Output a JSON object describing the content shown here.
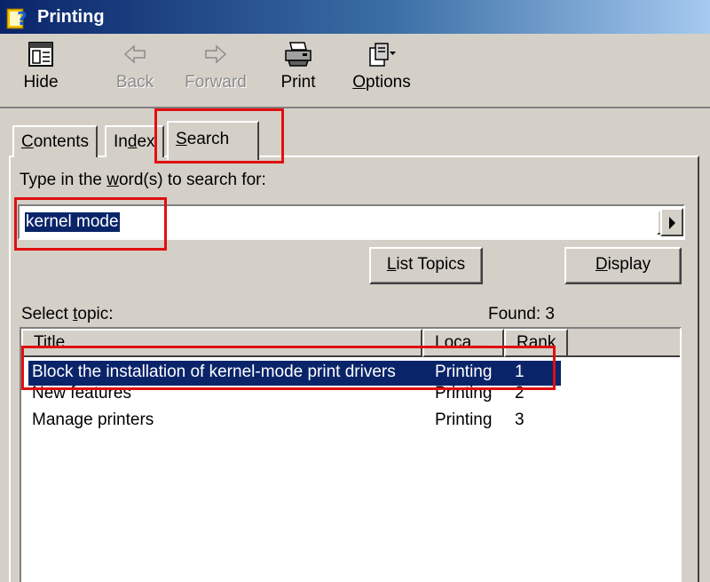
{
  "window": {
    "title": "Printing"
  },
  "toolbar": {
    "hide": "Hide",
    "back": "Back",
    "forward": "Forward",
    "print": "Print",
    "options_accel": "O",
    "options_rest": "ptions"
  },
  "tabs": {
    "contents_accel": "C",
    "contents_rest": "ontents",
    "index_pre": "In",
    "index_accel": "d",
    "index_rest": "ex",
    "search_accel": "S",
    "search_rest": "earch"
  },
  "search": {
    "prompt_pre": "Type in the ",
    "prompt_accel": "w",
    "prompt_rest": "ord(s) to search for:",
    "query": "kernel mode",
    "list_topics_accel": "L",
    "list_topics_rest": "ist Topics",
    "display_accel": "D",
    "display_rest": "isplay",
    "select_topic_pre": "Select ",
    "select_topic_accel": "t",
    "select_topic_rest": "opic:",
    "found": "Found: 3"
  },
  "results": {
    "columns": [
      "Title",
      "Loca...",
      "Rank"
    ],
    "rows": [
      {
        "title": "Block the installation of kernel-mode print drivers",
        "location": "Printing",
        "rank": "1"
      },
      {
        "title": "New features",
        "location": "Printing",
        "rank": "2"
      },
      {
        "title": "Manage printers",
        "location": "Printing",
        "rank": "3"
      }
    ],
    "selected_index": 0
  },
  "colors": {
    "selection": "#0a246a",
    "annotation": "#e01010",
    "face": "#d4d0c8"
  },
  "icons": [
    "help-book-icon",
    "hide-icon",
    "back-arrow-icon",
    "forward-arrow-icon",
    "printer-icon",
    "options-icon"
  ]
}
